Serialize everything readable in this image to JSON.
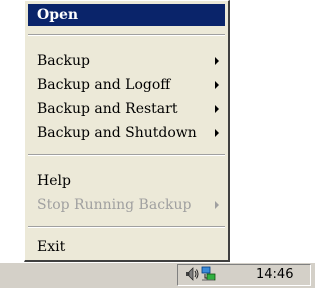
{
  "menu": {
    "items": [
      {
        "label": "Open"
      },
      {
        "label": "Backup"
      },
      {
        "label": "Backup and Logoff"
      },
      {
        "label": "Backup and Restart"
      },
      {
        "label": "Backup and Shutdown"
      },
      {
        "label": "Help"
      },
      {
        "label": "Stop Running Backup"
      },
      {
        "label": "Exit"
      }
    ]
  },
  "tray": {
    "clock": "14:46",
    "icons": [
      "speaker-icon",
      "network-icon"
    ]
  },
  "colors": {
    "menu_bg": "#ece9d8",
    "highlight": "#0a246a",
    "disabled_text": "#a0a0a0",
    "taskbar_bg": "#d4d0c8"
  }
}
